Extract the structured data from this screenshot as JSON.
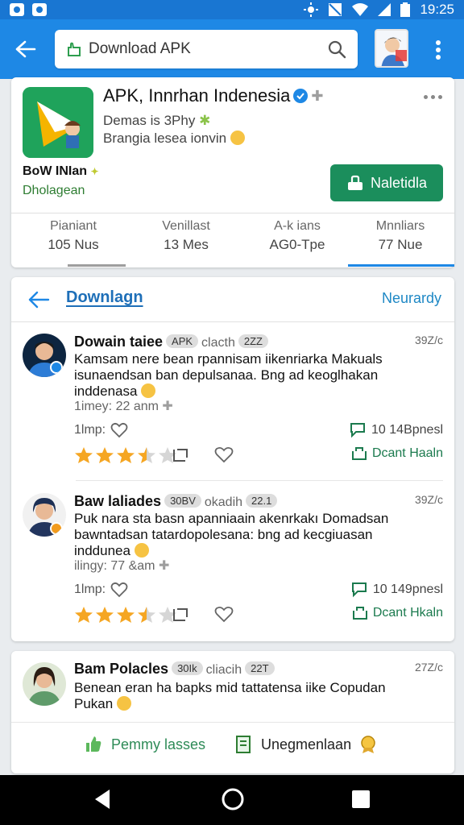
{
  "status_bar": {
    "time": "19:25"
  },
  "search": {
    "value": "Download APK"
  },
  "app": {
    "title": "APK, Innrhan Indenesia",
    "developer": "Demas is 3Phy",
    "category": "Brangia lesea ionvin",
    "brand": "BoW INIan",
    "status": "Dholagean",
    "install_label": "Naletidla",
    "stats": [
      {
        "label": "Pianiant",
        "value": "105 Nus"
      },
      {
        "label": "Venillast",
        "value": "13 Mes"
      },
      {
        "label": "A-k ians",
        "value": "AG0-Tpe"
      },
      {
        "label": "Mnnliars",
        "value": "77 Nue"
      }
    ]
  },
  "reviews": {
    "title": "Downlagn",
    "sort_label": "Neurardy",
    "items": [
      {
        "name": "Dowain taiee",
        "badge": "APK",
        "meta": "clacth",
        "count": "2ZZ",
        "date": "39Z/c",
        "text": "Kamsam nere bean rpannisam iikenriarka Makuals isunaendsan ban depulsanaa. Bng ad keoglhakan inddenasa",
        "time": "1imey: 22 anm",
        "like": "1lmp:",
        "helpful": "10 14Bpnesl",
        "reply": "Dcant Haaln",
        "rating": 3.5
      },
      {
        "name": "Baw laliades",
        "badge": "30BV",
        "meta": "okadih",
        "count": "22.1",
        "date": "39Z/c",
        "text": "Puk nara sta basn apanniaain akenrkakı Domadsan bawntadsan tatardopolesana: bng ad kecgiuasan inddunea",
        "time": "ilingy: 77 &am",
        "like": "1lmp:",
        "helpful": "10 149pnesl",
        "reply": "Dcant Hkaln",
        "rating": 3.5
      }
    ]
  },
  "last_review": {
    "name": "Bam Polacles",
    "badge": "30Ik",
    "meta": "cliacih",
    "count": "22T",
    "date": "27Z/c",
    "text": "Benean eran ha bapks mid tattatensa iike Copudan Pukan",
    "actions": [
      {
        "label": "Pemmy lasses",
        "color": "#2e8b57"
      },
      {
        "label": "Unegmenlaan",
        "color": "#222222"
      }
    ]
  },
  "colors": {
    "primary": "#1e88e5",
    "install": "#1b8e5c",
    "star": "#f5a623",
    "link": "#1e6fb8"
  }
}
